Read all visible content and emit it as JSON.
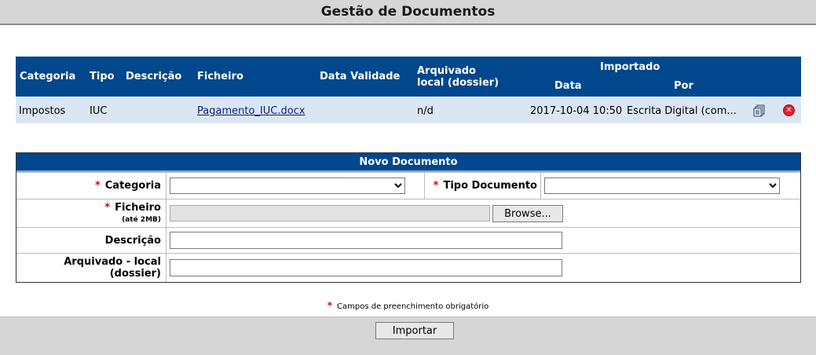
{
  "header": {
    "title": "Gestão de Documentos"
  },
  "documents": {
    "columns": {
      "categoria": "Categoria",
      "tipo": "Tipo",
      "descricao": "Descrição",
      "ficheiro": "Ficheiro",
      "data_validade": "Data Validade",
      "arquivado_l1": "Arquivado",
      "arquivado_l2": "local (dossier)",
      "importado": "Importado",
      "data": "Data",
      "por": "Por"
    },
    "rows": [
      {
        "categoria": "Impostos",
        "tipo": "IUC",
        "descricao": "",
        "ficheiro": "Pagamento_IUC.docx",
        "data_validade": "",
        "arquivado": "n/d",
        "data": "2017-10-04 10:50",
        "por": "Escrita Digital (com..."
      }
    ],
    "icons": {
      "copy": "copy-documents-icon",
      "delete": "delete-icon"
    }
  },
  "form": {
    "title": "Novo Documento",
    "required_mark": "*",
    "categoria_label": "Categoria",
    "categoria_value": "",
    "tipo_label": "Tipo Documento",
    "tipo_value": "",
    "ficheiro_label": "Ficheiro",
    "ficheiro_hint": "(até 2MB)",
    "browse_label": "Browse...",
    "descricao_label": "Descrição",
    "descricao_value": "",
    "arquivado_label_l1": "Arquivado - local",
    "arquivado_label_l2": "(dossier)",
    "arquivado_value": ""
  },
  "footer": {
    "required_note": "Campos de preenchimento obrigatório",
    "submit_label": "Importar"
  },
  "colors": {
    "header_blue": "#00478d",
    "row_blue": "#dbe6f5",
    "required_red": "#e00000"
  }
}
